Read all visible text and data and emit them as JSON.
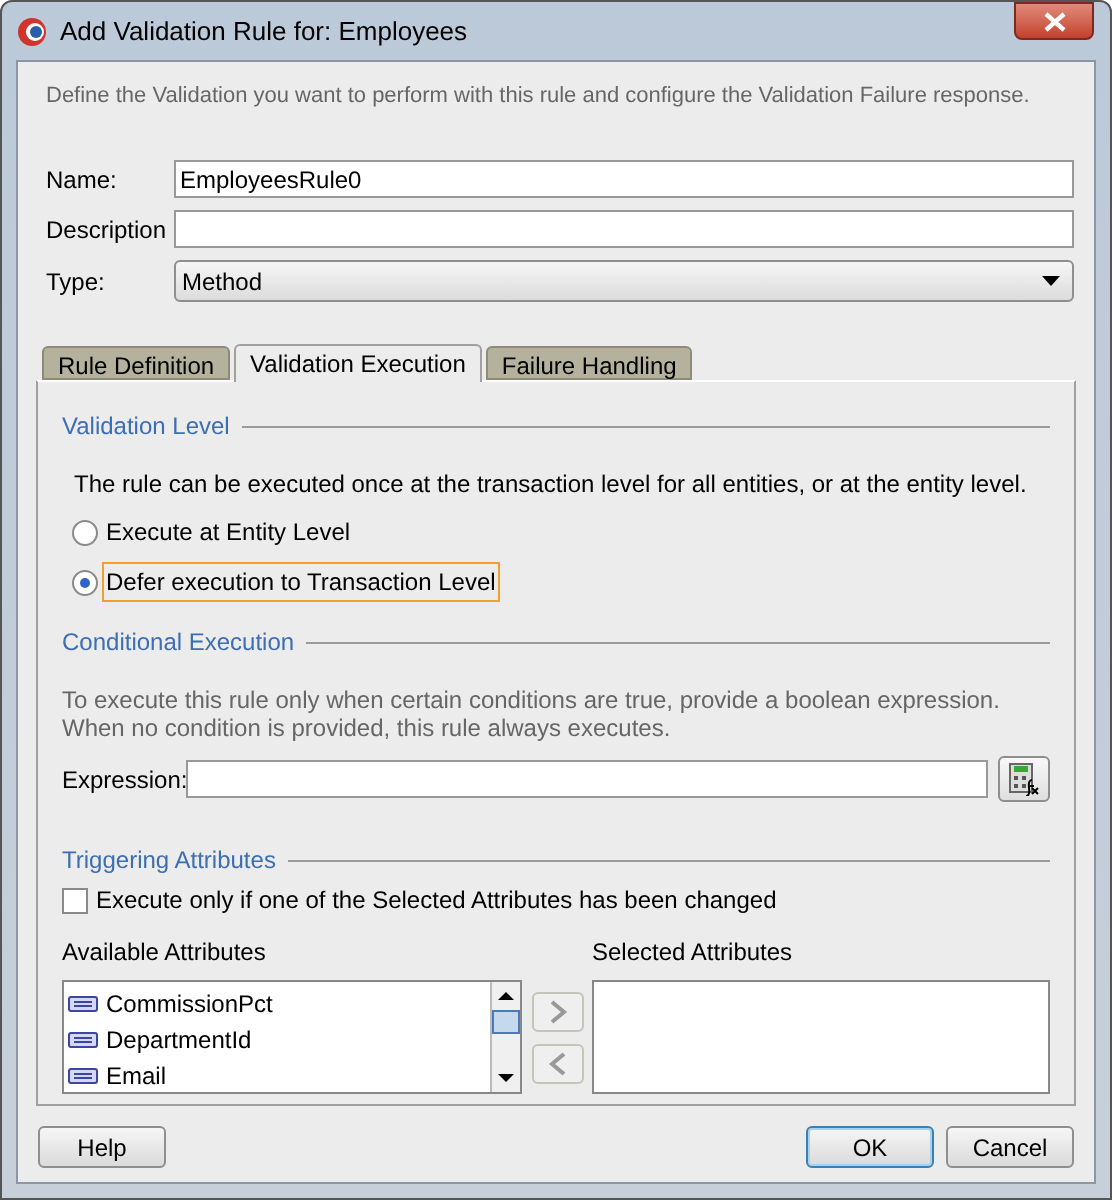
{
  "window": {
    "title": "Add Validation Rule for: Employees"
  },
  "intro": "Define the Validation you want to perform with this rule and configure the Validation Failure response.",
  "fields": [
    {
      "label": "Name:",
      "kind": "text",
      "value": "EmployeesRule0"
    },
    {
      "label": "Description",
      "kind": "text"
    },
    {
      "label": "Type:",
      "kind": "dropdown",
      "value": "Method"
    }
  ],
  "tabs": [
    {
      "label": "Rule Definition",
      "selected": false
    },
    {
      "label": "Validation Execution",
      "selected": true
    },
    {
      "label": "Failure Handling",
      "selected": false
    }
  ],
  "validation_level": {
    "heading": "Validation Level",
    "text": "The rule can be executed once at the transaction level for all entities, or at the entity level.",
    "options": [
      {
        "label": "Execute at Entity Level",
        "selected": false
      },
      {
        "label": "Defer execution to Transaction Level",
        "selected": true
      }
    ]
  },
  "conditional_execution": {
    "heading": "Conditional Execution",
    "text": "To execute this rule only when certain conditions are true, provide a boolean expression. When no condition is provided, this rule always executes.",
    "expression_label": "Expression:"
  },
  "triggering_attributes": {
    "heading": "Triggering Attributes",
    "checkbox": {
      "label": "Execute only if one of the Selected Attributes has been changed",
      "checked": false
    },
    "available_label": "Available Attributes",
    "available": [
      "CommissionPct",
      "DepartmentId",
      "Email"
    ],
    "selected_label": "Selected Attributes"
  },
  "buttons": [
    {
      "label": "Help",
      "default": false
    },
    {
      "label": "OK",
      "default": true
    },
    {
      "label": "Cancel",
      "default": false
    }
  ]
}
